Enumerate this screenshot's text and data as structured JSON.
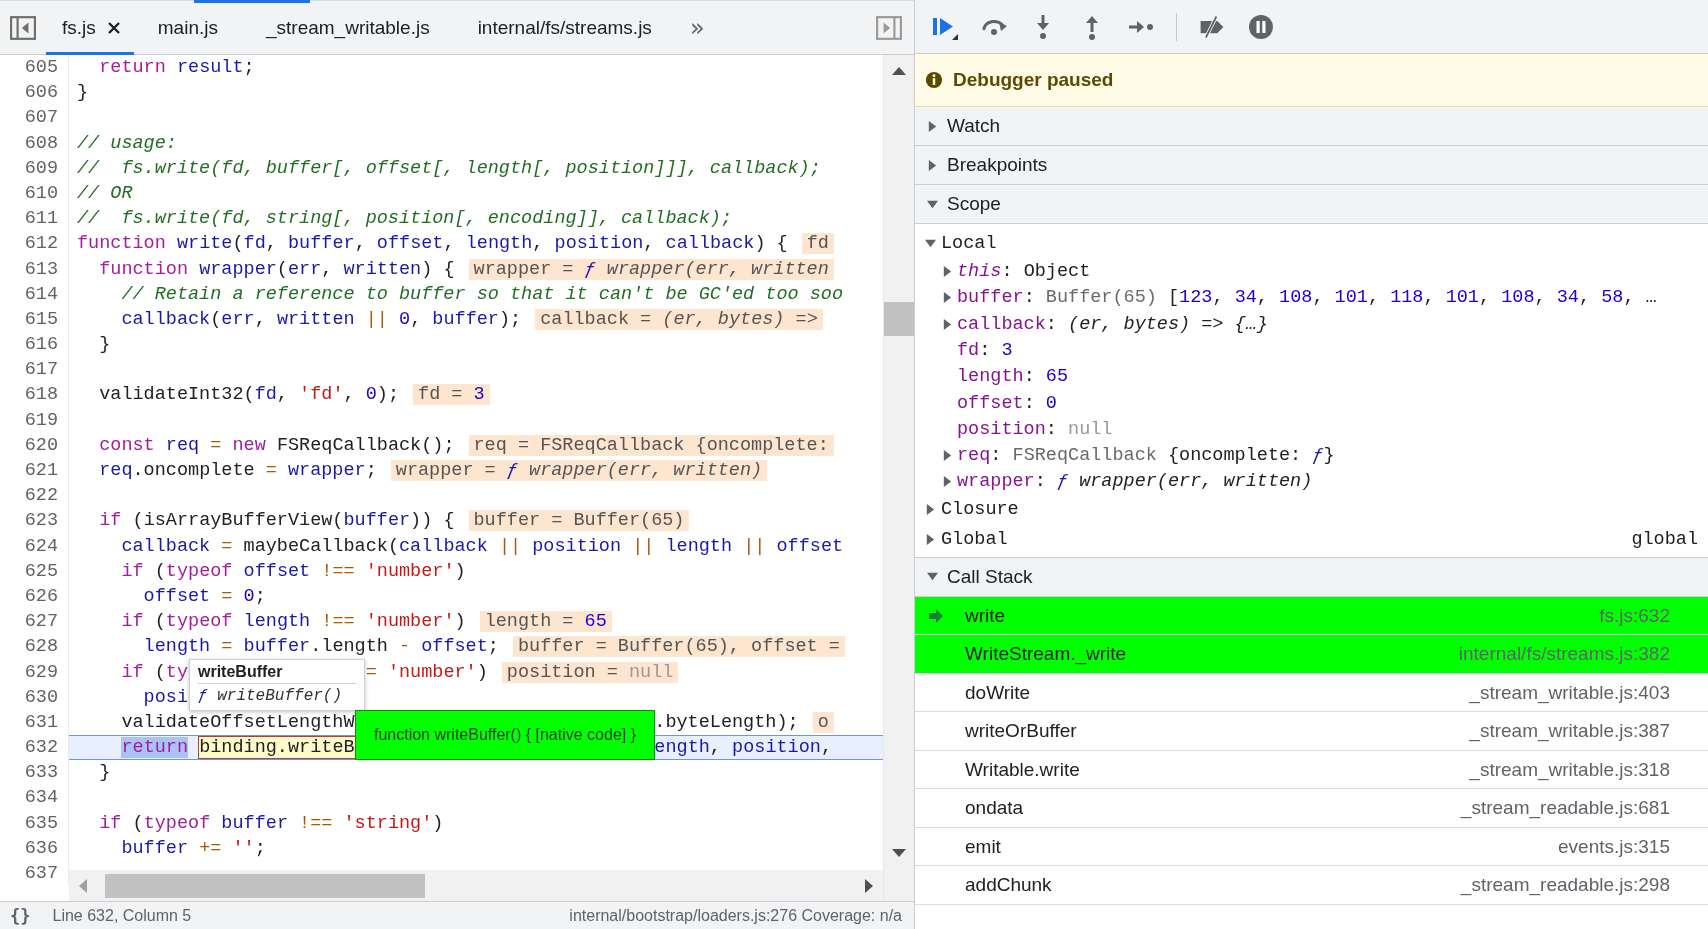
{
  "source_tabs": {
    "items": [
      {
        "label": "fs.js",
        "selected": true,
        "closable": true
      },
      {
        "label": "main.js",
        "selected": false,
        "closable": false
      },
      {
        "label": "_stream_writable.js",
        "selected": false,
        "closable": false
      },
      {
        "label": "internal/fs/streams.js",
        "selected": false,
        "closable": false
      }
    ],
    "more": "»"
  },
  "editor": {
    "lines": [
      {
        "number": "605",
        "current": false,
        "tokens": [
          {
            "kind": "keyword",
            "text": "  return"
          },
          {
            "kind": "def",
            "text": " result"
          },
          {
            "kind": "plain",
            "text": ";"
          }
        ]
      },
      {
        "number": "606",
        "current": false,
        "tokens": [
          {
            "kind": "plain",
            "text": "}"
          }
        ]
      },
      {
        "number": "607",
        "current": false
      },
      {
        "number": "608",
        "current": false,
        "tokens": [
          {
            "kind": "comment",
            "text": "// usage:"
          }
        ]
      },
      {
        "number": "609",
        "current": false,
        "tokens": [
          {
            "kind": "comment",
            "text": "//  fs.write(fd, buffer[, offset[, length[, position]]], callback);"
          }
        ]
      },
      {
        "number": "610",
        "current": false,
        "tokens": [
          {
            "kind": "comment",
            "text": "// OR"
          }
        ]
      },
      {
        "number": "611",
        "current": false,
        "tokens": [
          {
            "kind": "comment",
            "text": "//  fs.write(fd, string[, position[, encoding]], callback);"
          }
        ]
      },
      {
        "number": "612",
        "current": false,
        "tokens": [
          {
            "kind": "keyword",
            "text": "function"
          },
          {
            "kind": "def",
            "text": " write"
          },
          {
            "kind": "plain",
            "text": "("
          },
          {
            "kind": "def",
            "text": "fd"
          },
          {
            "kind": "plain",
            "text": ", "
          },
          {
            "kind": "def",
            "text": "buffer"
          },
          {
            "kind": "plain",
            "text": ", "
          },
          {
            "kind": "def",
            "text": "offset"
          },
          {
            "kind": "plain",
            "text": ", "
          },
          {
            "kind": "def",
            "text": "length"
          },
          {
            "kind": "plain",
            "text": ", "
          },
          {
            "kind": "def",
            "text": "position"
          },
          {
            "kind": "plain",
            "text": ", "
          },
          {
            "kind": "def",
            "text": "callback"
          },
          {
            "kind": "plain",
            "text": ") {"
          }
        ],
        "value": [
          {
            "kind": "plain",
            "text": "fd"
          }
        ]
      },
      {
        "number": "613",
        "current": false,
        "tokens": [
          {
            "kind": "keyword",
            "text": "  function"
          },
          {
            "kind": "def",
            "text": " wrapper"
          },
          {
            "kind": "plain",
            "text": "("
          },
          {
            "kind": "def",
            "text": "err"
          },
          {
            "kind": "plain",
            "text": ", "
          },
          {
            "kind": "def",
            "text": "written"
          },
          {
            "kind": "plain",
            "text": ") {"
          }
        ],
        "value": [
          {
            "kind": "plain",
            "text": "wrapper = "
          },
          {
            "kind": "fn",
            "text": "ƒ"
          },
          {
            "kind": "italic",
            "text": " wrapper(err, written"
          }
        ]
      },
      {
        "number": "614",
        "current": false,
        "tokens": [
          {
            "kind": "comment",
            "text": "    // Retain a reference to buffer so that it can't be GC'ed too soo"
          }
        ]
      },
      {
        "number": "615",
        "current": false,
        "tokens": [
          {
            "kind": "def",
            "text": "    callback"
          },
          {
            "kind": "plain",
            "text": "("
          },
          {
            "kind": "def",
            "text": "err"
          },
          {
            "kind": "plain",
            "text": ", "
          },
          {
            "kind": "def",
            "text": "written"
          },
          {
            "kind": "op",
            "text": " ||"
          },
          {
            "kind": "number",
            "text": " 0"
          },
          {
            "kind": "plain",
            "text": ", "
          },
          {
            "kind": "def",
            "text": "buffer"
          },
          {
            "kind": "plain",
            "text": ");"
          }
        ],
        "value": [
          {
            "kind": "plain",
            "text": "callback = "
          },
          {
            "kind": "italic",
            "text": "(er, bytes) =>"
          }
        ]
      },
      {
        "number": "616",
        "current": false,
        "tokens": [
          {
            "kind": "plain",
            "text": "  }"
          }
        ]
      },
      {
        "number": "617",
        "current": false
      },
      {
        "number": "618",
        "current": false,
        "tokens": [
          {
            "kind": "plain",
            "text": "  validateInt32("
          },
          {
            "kind": "def",
            "text": "fd"
          },
          {
            "kind": "plain",
            "text": ", "
          },
          {
            "kind": "string",
            "text": "'fd'"
          },
          {
            "kind": "plain",
            "text": ", "
          },
          {
            "kind": "number",
            "text": "0"
          },
          {
            "kind": "plain",
            "text": ");"
          }
        ],
        "value": [
          {
            "kind": "plain",
            "text": "fd = "
          },
          {
            "kind": "number",
            "text": "3"
          }
        ]
      },
      {
        "number": "619",
        "current": false
      },
      {
        "number": "620",
        "current": false,
        "tokens": [
          {
            "kind": "keyword",
            "text": "  const"
          },
          {
            "kind": "def",
            "text": " req"
          },
          {
            "kind": "op",
            "text": " ="
          },
          {
            "kind": "keyword",
            "text": " new"
          },
          {
            "kind": "plain",
            "text": " FSReqCallback();"
          }
        ],
        "value": [
          {
            "kind": "plain",
            "text": "req = FSReqCallback {oncomplete:"
          }
        ]
      },
      {
        "number": "621",
        "current": false,
        "tokens": [
          {
            "kind": "def",
            "text": "  req"
          },
          {
            "kind": "plain",
            "text": ".oncomplete"
          },
          {
            "kind": "op",
            "text": " ="
          },
          {
            "kind": "def",
            "text": " wrapper"
          },
          {
            "kind": "plain",
            "text": ";"
          }
        ],
        "value": [
          {
            "kind": "plain",
            "text": "wrapper = "
          },
          {
            "kind": "fn",
            "text": "ƒ"
          },
          {
            "kind": "italic",
            "text": " wrapper(err, written)"
          }
        ]
      },
      {
        "number": "622",
        "current": false
      },
      {
        "number": "623",
        "current": false,
        "tokens": [
          {
            "kind": "keyword",
            "text": "  if"
          },
          {
            "kind": "plain",
            "text": " (isArrayBufferView("
          },
          {
            "kind": "def",
            "text": "buffer"
          },
          {
            "kind": "plain",
            "text": ")) {"
          }
        ],
        "value": [
          {
            "kind": "plain",
            "text": "buffer = Buffer(65)"
          }
        ]
      },
      {
        "number": "624",
        "current": false,
        "tokens": [
          {
            "kind": "def",
            "text": "    callback"
          },
          {
            "kind": "op",
            "text": " ="
          },
          {
            "kind": "plain",
            "text": " maybeCallback("
          },
          {
            "kind": "def",
            "text": "callback"
          },
          {
            "kind": "op",
            "text": " ||"
          },
          {
            "kind": "def",
            "text": " position"
          },
          {
            "kind": "op",
            "text": " ||"
          },
          {
            "kind": "def",
            "text": " length"
          },
          {
            "kind": "op",
            "text": " ||"
          },
          {
            "kind": "def",
            "text": " offset"
          }
        ]
      },
      {
        "number": "625",
        "current": false,
        "tokens": [
          {
            "kind": "keyword",
            "text": "    if"
          },
          {
            "kind": "plain",
            "text": " ("
          },
          {
            "kind": "keyword",
            "text": "typeof"
          },
          {
            "kind": "def",
            "text": " offset"
          },
          {
            "kind": "op",
            "text": " !=="
          },
          {
            "kind": "string",
            "text": " 'number'"
          },
          {
            "kind": "plain",
            "text": ")"
          }
        ]
      },
      {
        "number": "626",
        "current": false,
        "tokens": [
          {
            "kind": "def",
            "text": "      offset"
          },
          {
            "kind": "op",
            "text": " ="
          },
          {
            "kind": "number",
            "text": " 0"
          },
          {
            "kind": "plain",
            "text": ";"
          }
        ]
      },
      {
        "number": "627",
        "current": false,
        "tokens": [
          {
            "kind": "keyword",
            "text": "    if"
          },
          {
            "kind": "plain",
            "text": " ("
          },
          {
            "kind": "keyword",
            "text": "typeof"
          },
          {
            "kind": "def",
            "text": " length"
          },
          {
            "kind": "op",
            "text": " !=="
          },
          {
            "kind": "string",
            "text": " 'number'"
          },
          {
            "kind": "plain",
            "text": ")"
          }
        ],
        "value": [
          {
            "kind": "plain",
            "text": "length = "
          },
          {
            "kind": "number",
            "text": "65"
          }
        ]
      },
      {
        "number": "628",
        "current": false,
        "tokens": [
          {
            "kind": "def",
            "text": "      length"
          },
          {
            "kind": "op",
            "text": " ="
          },
          {
            "kind": "def",
            "text": " buffer"
          },
          {
            "kind": "plain",
            "text": ".length"
          },
          {
            "kind": "op",
            "text": " -"
          },
          {
            "kind": "def",
            "text": " offset"
          },
          {
            "kind": "plain",
            "text": ";"
          }
        ],
        "value": [
          {
            "kind": "plain",
            "text": "buffer = Buffer(65), offset ="
          }
        ]
      },
      {
        "number": "629",
        "current": false,
        "tokens": [
          {
            "kind": "keyword",
            "text": "    if"
          },
          {
            "kind": "plain",
            "text": " ("
          },
          {
            "kind": "keyword",
            "text": "ty"
          },
          {
            "kind": "op",
            "text": "                ="
          },
          {
            "kind": "string",
            "text": " 'number'"
          },
          {
            "kind": "plain",
            "text": ")"
          }
        ],
        "value": [
          {
            "kind": "plain",
            "text": "position = "
          },
          {
            "kind": "null",
            "text": "null"
          }
        ]
      },
      {
        "number": "630",
        "current": false,
        "tokens": [
          {
            "kind": "def",
            "text": "      posi"
          }
        ]
      },
      {
        "number": "631",
        "current": false,
        "tokens": [
          {
            "kind": "plain",
            "text": "    validateOffsetLengthW                           .byteLength);"
          }
        ],
        "value": [
          {
            "kind": "plain",
            "text": "o"
          }
        ]
      },
      {
        "number": "632",
        "current": true,
        "tokens": [
          {
            "kind": "keyword",
            "text": "    return",
            "selected": true
          },
          {
            "kind": "plain",
            "text": " binding.writeB",
            "hovered": true
          },
          {
            "kind": "def",
            "text": "                           ength"
          },
          {
            "kind": "plain",
            "text": ","
          },
          {
            "kind": "def",
            "text": " position"
          },
          {
            "kind": "plain",
            "text": ","
          }
        ]
      },
      {
        "number": "633",
        "current": false,
        "tokens": [
          {
            "kind": "plain",
            "text": "  }"
          }
        ]
      },
      {
        "number": "634",
        "current": false
      },
      {
        "number": "635",
        "current": false,
        "tokens": [
          {
            "kind": "keyword",
            "text": "  if"
          },
          {
            "kind": "plain",
            "text": " ("
          },
          {
            "kind": "keyword",
            "text": "typeof"
          },
          {
            "kind": "def",
            "text": " buffer"
          },
          {
            "kind": "op",
            "text": " !=="
          },
          {
            "kind": "string",
            "text": " 'string'"
          },
          {
            "kind": "plain",
            "text": ")"
          }
        ]
      },
      {
        "number": "636",
        "current": false,
        "tokens": [
          {
            "kind": "def",
            "text": "    buffer"
          },
          {
            "kind": "op",
            "text": " +="
          },
          {
            "kind": "string",
            "text": " ''"
          },
          {
            "kind": "plain",
            "text": ";"
          }
        ]
      },
      {
        "number": "637"
      }
    ],
    "popover": {
      "title": "writeBuffer",
      "body": [
        {
          "kind": "fn",
          "text": "ƒ"
        },
        {
          "kind": "italic",
          "text": " writeBuffer()"
        }
      ]
    },
    "tooltip": "function writeBuffer() { [native code] }"
  },
  "status_bar": {
    "format": "{}",
    "position": "Line 632, Column 5",
    "source": "internal/bootstrap/loaders.js:276  Coverage: n/a"
  },
  "debugger": {
    "banner": "Debugger paused",
    "sections": [
      {
        "label": "Watch",
        "expanded": false
      },
      {
        "label": "Breakpoints",
        "expanded": false
      },
      {
        "kind": "scope",
        "label": "Scope",
        "expanded": true,
        "groups": [
          {
            "label": "Local",
            "expanded": true,
            "entries": [
              {
                "expandable": true,
                "tokens": [
                  {
                    "kind": "prop-italic",
                    "text": "this"
                  },
                  {
                    "kind": "plain",
                    "text": ": Object"
                  }
                ]
              },
              {
                "expandable": true,
                "tokens": [
                  {
                    "kind": "prop",
                    "text": "buffer"
                  },
                  {
                    "kind": "plain",
                    "text": ": "
                  },
                  {
                    "kind": "gray",
                    "text": "Buffer(65)"
                  },
                  {
                    "kind": "plain",
                    "text": " ["
                  },
                  {
                    "kind": "number",
                    "text": "123"
                  },
                  {
                    "kind": "plain",
                    "text": ", "
                  },
                  {
                    "kind": "number",
                    "text": "34"
                  },
                  {
                    "kind": "plain",
                    "text": ", "
                  },
                  {
                    "kind": "number",
                    "text": "108"
                  },
                  {
                    "kind": "plain",
                    "text": ", "
                  },
                  {
                    "kind": "number",
                    "text": "101"
                  },
                  {
                    "kind": "plain",
                    "text": ", "
                  },
                  {
                    "kind": "number",
                    "text": "118"
                  },
                  {
                    "kind": "plain",
                    "text": ", "
                  },
                  {
                    "kind": "number",
                    "text": "101"
                  },
                  {
                    "kind": "plain",
                    "text": ", "
                  },
                  {
                    "kind": "number",
                    "text": "108"
                  },
                  {
                    "kind": "plain",
                    "text": ", "
                  },
                  {
                    "kind": "number",
                    "text": "34"
                  },
                  {
                    "kind": "plain",
                    "text": ", "
                  },
                  {
                    "kind": "number",
                    "text": "58"
                  },
                  {
                    "kind": "plain",
                    "text": ", …"
                  }
                ]
              },
              {
                "expandable": true,
                "tokens": [
                  {
                    "kind": "prop",
                    "text": "callback"
                  },
                  {
                    "kind": "plain",
                    "text": ": "
                  },
                  {
                    "kind": "italic",
                    "text": "(er, bytes) => {…}"
                  }
                ]
              },
              {
                "expandable": false,
                "tokens": [
                  {
                    "kind": "prop",
                    "text": "fd"
                  },
                  {
                    "kind": "plain",
                    "text": ": "
                  },
                  {
                    "kind": "number",
                    "text": "3"
                  }
                ]
              },
              {
                "expandable": false,
                "tokens": [
                  {
                    "kind": "prop",
                    "text": "length"
                  },
                  {
                    "kind": "plain",
                    "text": ": "
                  },
                  {
                    "kind": "number",
                    "text": "65"
                  }
                ]
              },
              {
                "expandable": false,
                "tokens": [
                  {
                    "kind": "prop",
                    "text": "offset"
                  },
                  {
                    "kind": "plain",
                    "text": ": "
                  },
                  {
                    "kind": "number",
                    "text": "0"
                  }
                ]
              },
              {
                "expandable": false,
                "tokens": [
                  {
                    "kind": "prop",
                    "text": "position"
                  },
                  {
                    "kind": "plain",
                    "text": ": "
                  },
                  {
                    "kind": "null",
                    "text": "null"
                  }
                ]
              },
              {
                "expandable": true,
                "tokens": [
                  {
                    "kind": "prop",
                    "text": "req"
                  },
                  {
                    "kind": "plain",
                    "text": ": "
                  },
                  {
                    "kind": "gray",
                    "text": "FSReqCallback"
                  },
                  {
                    "kind": "plain",
                    "text": " {oncomplete: "
                  },
                  {
                    "kind": "fn",
                    "text": "ƒ"
                  },
                  {
                    "kind": "plain",
                    "text": "}"
                  }
                ]
              },
              {
                "expandable": true,
                "tokens": [
                  {
                    "kind": "prop",
                    "text": "wrapper"
                  },
                  {
                    "kind": "plain",
                    "text": ": "
                  },
                  {
                    "kind": "fn",
                    "text": "ƒ"
                  },
                  {
                    "kind": "italic",
                    "text": " wrapper(err, written)"
                  }
                ]
              }
            ]
          },
          {
            "label": "Closure",
            "expanded": false
          },
          {
            "label": "Global",
            "expanded": false,
            "value": "global"
          }
        ]
      },
      {
        "kind": "call_stack",
        "label": "Call Stack",
        "expanded": true,
        "frames": [
          {
            "function": "write",
            "location": "fs.js:632",
            "selected": true,
            "marked": true
          },
          {
            "function": "WriteStream._write",
            "location": "internal/fs/streams.js:382",
            "selected": false,
            "marked": true
          },
          {
            "function": "doWrite",
            "location": "_stream_writable.js:403",
            "selected": false,
            "marked": false
          },
          {
            "function": "writeOrBuffer",
            "location": "_stream_writable.js:387",
            "selected": false,
            "marked": false
          },
          {
            "function": "Writable.write",
            "location": "_stream_writable.js:318",
            "selected": false,
            "marked": false
          },
          {
            "function": "ondata",
            "location": "_stream_readable.js:681",
            "selected": false,
            "marked": false
          },
          {
            "function": "emit",
            "location": "events.js:315",
            "selected": false,
            "marked": false
          },
          {
            "function": "addChunk",
            "location": "_stream_readable.js:298",
            "selected": false,
            "marked": false
          }
        ]
      }
    ]
  }
}
